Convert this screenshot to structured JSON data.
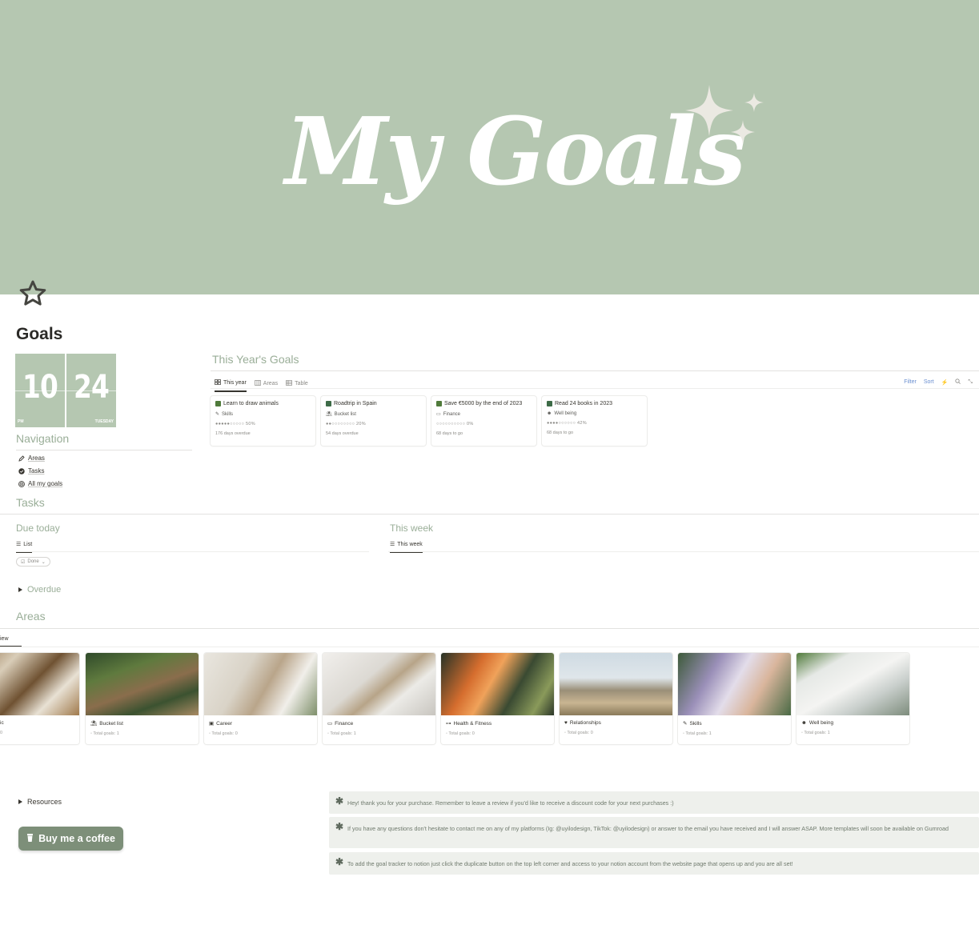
{
  "cover": {
    "title": "My Goals",
    "color": "#b5c7b1"
  },
  "page": {
    "icon": "star-outline-icon",
    "title": "Goals"
  },
  "calendar": {
    "month": "10",
    "day": "24",
    "month_small": "PM",
    "weekday": "TUESDAY"
  },
  "navigation": {
    "heading": "Navigation",
    "items": [
      {
        "label": "Areas",
        "icon": "pencil-icon"
      },
      {
        "label": "Tasks",
        "icon": "check-circle-icon"
      },
      {
        "label": "All my goals",
        "icon": "target-icon"
      }
    ]
  },
  "goals_section": {
    "heading": "This Year's Goals",
    "tabs": [
      {
        "label": "This year",
        "icon": "gallery-icon",
        "active": true
      },
      {
        "label": "Areas",
        "icon": "board-icon",
        "active": false
      },
      {
        "label": "Table",
        "icon": "table-icon",
        "active": false
      }
    ],
    "toolbar": {
      "filter": "Filter",
      "sort": "Sort"
    },
    "cards": [
      {
        "title": "Learn to draw animals",
        "area": "Skills",
        "progress": "●●●●●○○○○○ 50%",
        "due": "176 days overdue",
        "icon_color": "#4f7a3a"
      },
      {
        "title": "Roadtrip in Spain",
        "area": "Bucket list",
        "progress": "●●○○○○○○○○ 20%",
        "due": "54 days overdue",
        "icon_color": "#3d6b47"
      },
      {
        "title": "Save €5000 by the end of 2023",
        "area": "Finance",
        "progress": "○○○○○○○○○○ 0%",
        "due": "68 days to go",
        "icon_color": "#4f7a3a"
      },
      {
        "title": "Read 24 books in 2023",
        "area": "Well being",
        "progress": "●●●●○○○○○○ 42%",
        "due": "68 days to go",
        "icon_color": "#3d6b47"
      }
    ]
  },
  "tasks_section": {
    "heading": "Tasks",
    "due_today": {
      "heading": "Due today",
      "tab": "List",
      "filter": "Done"
    },
    "this_week": {
      "heading": "This week",
      "tab": "This week"
    },
    "overdue": "Overdue"
  },
  "areas_section": {
    "heading": "Areas",
    "tab": "iew",
    "cards": [
      {
        "name": "ic",
        "count": "0"
      },
      {
        "name": "Bucket list",
        "count": "Total goals: 1"
      },
      {
        "name": "Career",
        "count": "Total goals: 0"
      },
      {
        "name": "Finance",
        "count": "Total goals: 1"
      },
      {
        "name": "Health & Fitness",
        "count": "Total goals: 0"
      },
      {
        "name": "Relationships",
        "count": "Total goals: 0"
      },
      {
        "name": "Skills",
        "count": "Total goals: 1"
      },
      {
        "name": "Well being",
        "count": "Total goals: 1"
      }
    ]
  },
  "resources": "Resources",
  "coffee_button": "Buy me a coffee",
  "callouts": [
    "Hey! thank you for your purchase. Remember to leave a review if you'd like to receive a discount code for your next purchases :)",
    "If you have any questions don't hesitate to contact me on any of my platforms (Ig: @uyilodesign, TikTok: @uyilodesign) or answer to the email you have received and I will answer ASAP. More templates will soon be available on Gumroad",
    "To add the goal tracker to notion just click the duplicate button on the top left corner and access to your notion account from the website page that opens up and you are all set!"
  ]
}
